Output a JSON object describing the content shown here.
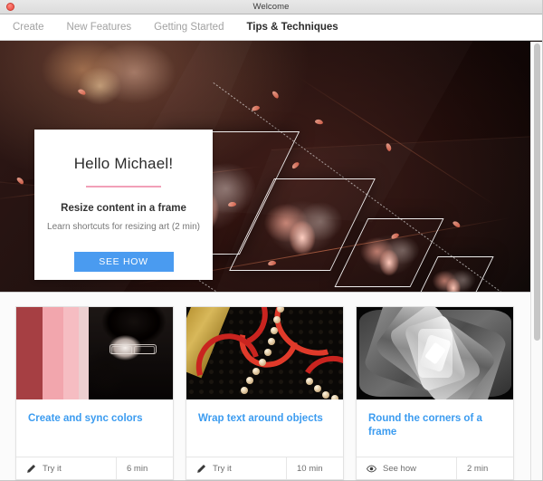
{
  "window": {
    "title": "Welcome",
    "close_button": "close-button"
  },
  "tabs": [
    {
      "label": "Create",
      "active": false
    },
    {
      "label": "New Features",
      "active": false
    },
    {
      "label": "Getting Started",
      "active": false
    },
    {
      "label": "Tips & Techniques",
      "active": true
    }
  ],
  "hero": {
    "alt": "Lotus flowers repeating in shrinking frames on a dark red background",
    "card": {
      "greeting": "Hello Michael!",
      "headline": "Resize content in a frame",
      "description": "Learn shortcuts for resizing art (2 min)",
      "button_label": "SEE HOW",
      "button_color": "#4a9bf0",
      "rule_color": "#f2a0b8"
    }
  },
  "cards": [
    {
      "title": "Create and sync colors",
      "action_icon": "pencil-icon",
      "action_label": "Try it",
      "duration": "6 min",
      "thumb": "portrait-pink-stripes"
    },
    {
      "title": "Wrap text around objects",
      "action_icon": "pencil-icon",
      "action_label": "Try it",
      "duration": "10 min",
      "thumb": "red-ribbons-pearls"
    },
    {
      "title": "Round the corners of a frame",
      "action_icon": "eye-icon",
      "action_label": "See how",
      "duration": "2 min",
      "thumb": "grayscale-rose"
    }
  ],
  "colors": {
    "link": "#3c9cf0",
    "accent": "#4a9bf0",
    "tab_active": "#2c2c2c",
    "tab_inactive": "#a2a2a2"
  }
}
